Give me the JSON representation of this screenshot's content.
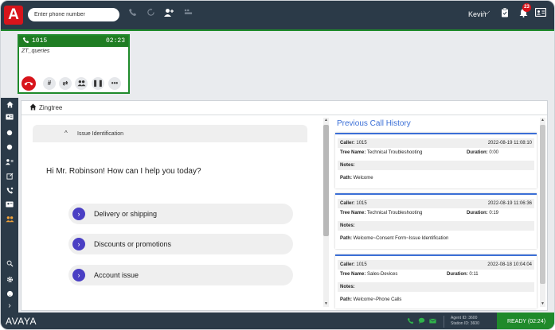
{
  "topbar": {
    "logo": "A",
    "phone_placeholder": "Enter phone number",
    "user_name": "Kevin",
    "notification_count": "23",
    "icons": [
      "phone-icon",
      "redial-icon",
      "add-contact-icon",
      "dialpad-icon",
      "clipboard-icon",
      "bell-icon",
      "contact-card-icon"
    ]
  },
  "call": {
    "number": "1015",
    "timer": "02:23",
    "queue": "ZT_queries",
    "controls": [
      "hang-up-icon",
      "keypad-icon",
      "transfer-icon",
      "conference-icon",
      "hold-icon",
      "more-icon"
    ],
    "keypad_label": "#",
    "transfer_label": "⇄",
    "hold_label": "❚❚",
    "more_label": "•••"
  },
  "breadcrumb": {
    "label": "Zingtree"
  },
  "flow": {
    "section_title": "Issue Identification",
    "greeting": "Hi Mr. Robinson! How can I help you today?",
    "options": [
      "Delivery or shipping",
      "Discounts or promotions",
      "Account issue"
    ]
  },
  "history": {
    "title": "Previous Call History",
    "caller_label": "Caller:",
    "tree_label": "Tree Name:",
    "duration_label": "Duration:",
    "notes_label": "Notes:",
    "path_label": "Path:",
    "calls": [
      {
        "caller": "1015",
        "date": "2022-08-19 11:08:10",
        "tree": "Technical Troubleshooting",
        "duration": "0:00",
        "path": "Welcome"
      },
      {
        "caller": "1015",
        "date": "2022-08-19 11:06:36",
        "tree": "Technical Troubleshooting",
        "duration": "0:19",
        "path": "Welcome~Consent Form~Issue Identification"
      },
      {
        "caller": "1015",
        "date": "2022-08-18 10:04:04",
        "tree": "Sales-Devices",
        "duration": "0:11",
        "path": "Welcome~Phone Calls"
      }
    ]
  },
  "footer": {
    "brand": "AVAYA",
    "agent_id": "Agent ID: 3600",
    "station_id": "Station ID: 3600",
    "status": "READY (02:24)"
  },
  "colors": {
    "navy": "#2b3a48",
    "green": "#1f8a2b",
    "red": "#d8141b",
    "blue": "#3b6fd6",
    "purple": "#4a3fc4",
    "orange": "#f2a33a"
  }
}
